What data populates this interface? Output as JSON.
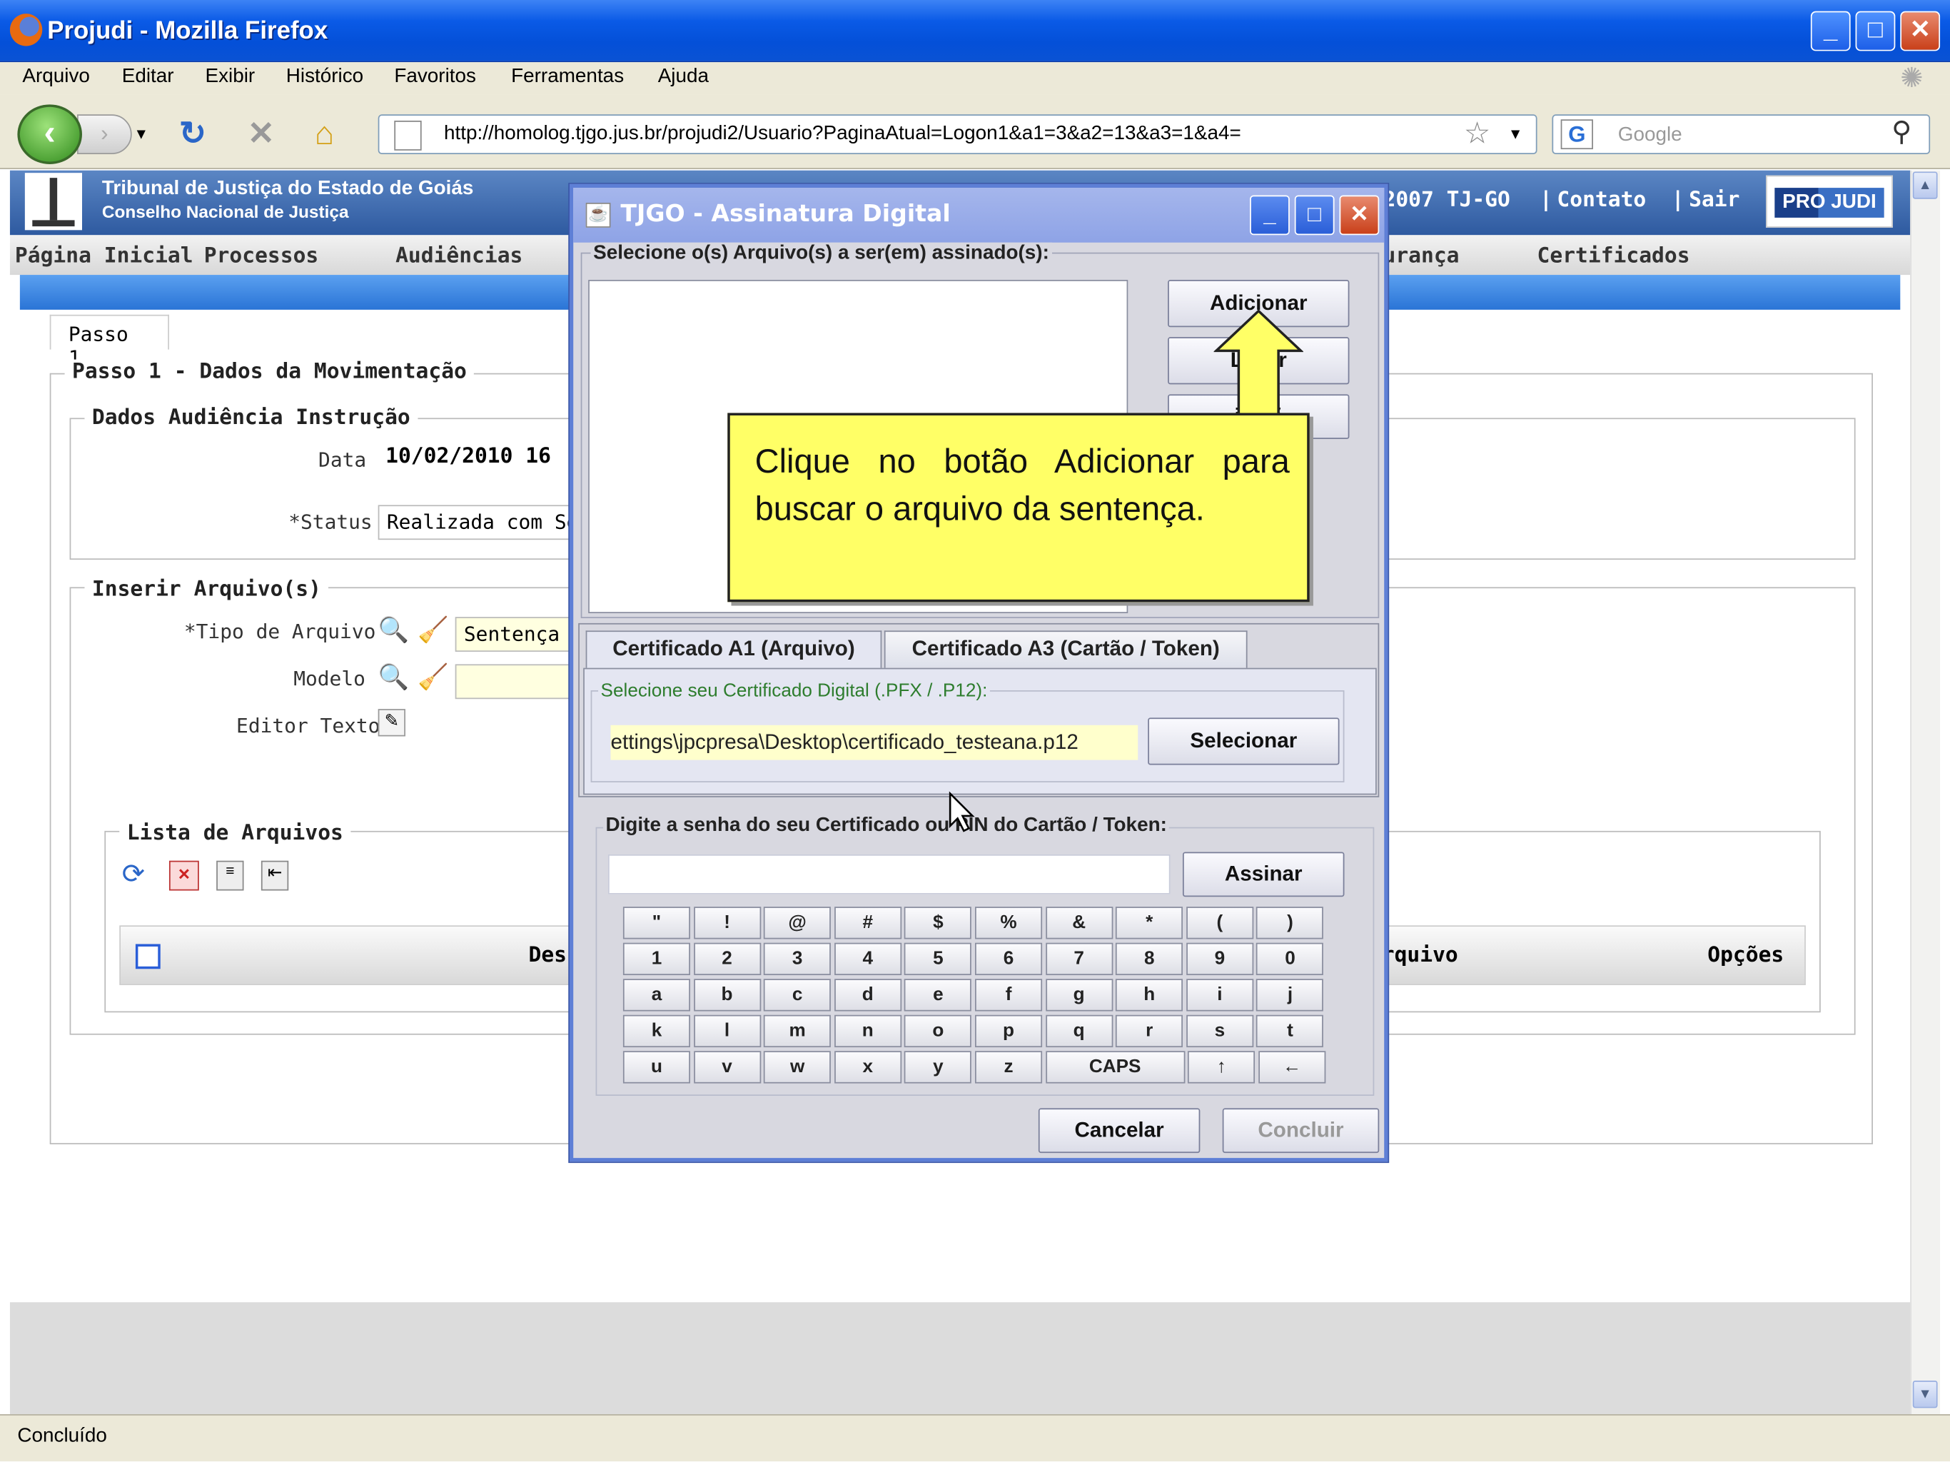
{
  "window": {
    "title": "Projudi - Mozilla Firefox"
  },
  "menubar": {
    "items": [
      "Arquivo",
      "Editar",
      "Exibir",
      "Histórico",
      "Favoritos",
      "Ferramentas",
      "Ajuda"
    ]
  },
  "navbar": {
    "url": "http://homolog.tjgo.jus.br/projudi2/Usuario?PaginaAtual=Logon1&a1=3&a2=13&a3=1&a4=",
    "search_placeholder": "Google"
  },
  "page": {
    "org_line1": "Tribunal de Justiça do Estado de Goiás",
    "org_line2": "Conselho Nacional de Justiça",
    "top_links": [
      "2007 TJ-GO",
      "Contato",
      "Sair"
    ],
    "logo": "PRO JUDI",
    "menu": [
      "Página Inicial",
      "Processos",
      "Audiências",
      "urança",
      "Certificados"
    ],
    "step_tab": "Passo 1",
    "step_legend": "Passo 1 - Dados da Movimentação",
    "audiencia_legend": "Dados Audiência Instrução",
    "data_label": "Data",
    "data_value": "10/02/2010 16",
    "status_label": "*Status",
    "status_value": "Realizada com Se",
    "inserir_legend": "Inserir Arquivo(s)",
    "tipo_label": "*Tipo de Arquivo",
    "tipo_value": "Sentença",
    "modelo_label": "Modelo",
    "editor_label": "Editor Texto",
    "lista_legend": "Lista de Arquivos",
    "table_headers": [
      "Des",
      "rquivo",
      "Opções"
    ]
  },
  "statusbar": {
    "text": "Concluído"
  },
  "dialog": {
    "title": "TJGO - Assinatura Digital",
    "select_label": "Selecione o(s) Arquivo(s) a ser(em) assinado(s):",
    "btn_add": "Adicionar",
    "btn_limpar": "Li   ar",
    "btn_info": "i f   ã",
    "tab_a1": "Certificado A1 (Arquivo)",
    "tab_a3": "Certificado A3 (Cartão / Token)",
    "cert_label": "Selecione seu Certificado Digital (.PFX / .P12):",
    "cert_path": "ettings\\jpcpresa\\Desktop\\certificado_testeana.p12",
    "btn_selecionar": "Selecionar",
    "pin_label": "Digite a senha do seu Certificado ou PIN do Cartão / Token:",
    "btn_assinar": "Assinar",
    "keys": [
      [
        "\"",
        "!",
        "@",
        "#",
        "$",
        "%",
        "&",
        "*",
        "(",
        ")"
      ],
      [
        "1",
        "2",
        "3",
        "4",
        "5",
        "6",
        "7",
        "8",
        "9",
        "0"
      ],
      [
        "a",
        "b",
        "c",
        "d",
        "e",
        "f",
        "g",
        "h",
        "i",
        "j"
      ],
      [
        "k",
        "l",
        "m",
        "n",
        "o",
        "p",
        "q",
        "r",
        "s",
        "t"
      ],
      [
        "u",
        "v",
        "w",
        "x",
        "y",
        "z",
        "CAPS",
        "↑",
        "←"
      ]
    ],
    "btn_cancelar": "Cancelar",
    "btn_concluir": "Concluir"
  },
  "callout": {
    "text": "Clique no botão Adicionar para buscar o arquivo da sentença."
  },
  "colors": {
    "accent": "#2a74d6",
    "callout": "#ffff66"
  }
}
